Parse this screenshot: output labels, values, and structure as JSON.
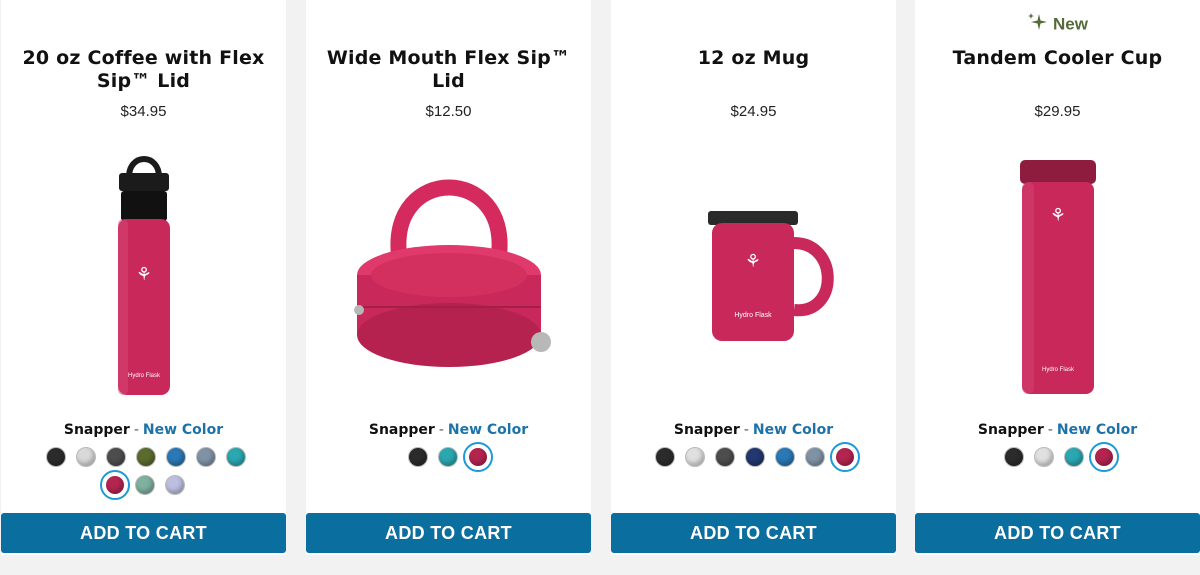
{
  "products": [
    {
      "title": "20 oz Coffee with Flex Sip™ Lid",
      "price": "$34.95",
      "color_name": "Snapper",
      "color_tag": "New Color",
      "swatches": [
        "#2b2b2b",
        "#d9d9d9",
        "#4d4d4d",
        "#5b6b2e",
        "#2a78b5",
        "#7f93a6",
        "#2aa7b0",
        "#b3244f",
        "#7fb0a0",
        "#bdbfe0"
      ],
      "selected_swatch": 7,
      "cta": "ADD TO CART",
      "badge": ""
    },
    {
      "title": "Wide Mouth Flex Sip™ Lid",
      "price": "$12.50",
      "color_name": "Snapper",
      "color_tag": "New Color",
      "swatches": [
        "#2b2b2b",
        "#2aa7b0",
        "#b3244f"
      ],
      "selected_swatch": 2,
      "cta": "ADD TO CART",
      "badge": ""
    },
    {
      "title": "12 oz Mug",
      "price": "$24.95",
      "color_name": "Snapper",
      "color_tag": "New Color",
      "swatches": [
        "#2b2b2b",
        "#e0e0e0",
        "#4d4d4d",
        "#22386e",
        "#2a78b5",
        "#7f93a6",
        "#b3244f"
      ],
      "selected_swatch": 6,
      "cta": "ADD TO CART",
      "badge": ""
    },
    {
      "title": "Tandem Cooler Cup",
      "price": "$29.95",
      "color_name": "Snapper",
      "color_tag": "New Color",
      "swatches": [
        "#2b2b2b",
        "#e0e0e0",
        "#2aa7b0",
        "#b3244f"
      ],
      "selected_swatch": 3,
      "cta": "ADD TO CART",
      "badge": "New"
    }
  ],
  "colors": {
    "accent": "#0a6e9e",
    "new_color_text": "#1d72a8",
    "badge": "#556b3a",
    "product": "#c8285a"
  },
  "icons": {
    "badge": "sparkle-icon"
  }
}
